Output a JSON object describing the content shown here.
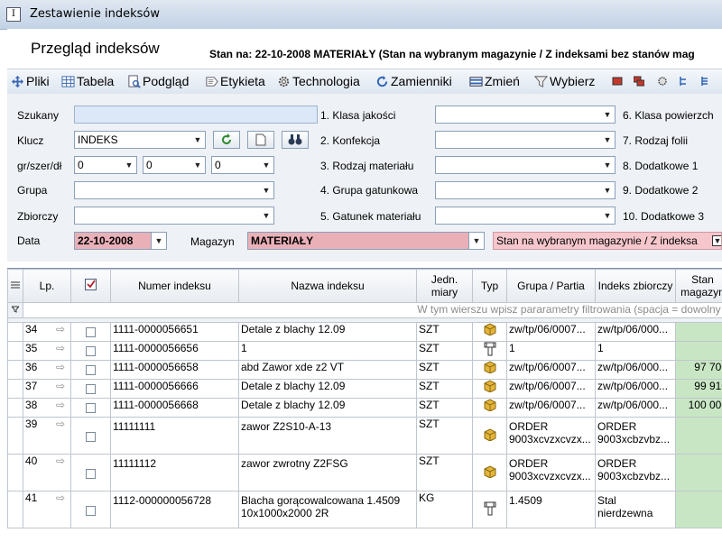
{
  "window": {
    "title": "Zestawienie indeksów",
    "icon": "I"
  },
  "header": {
    "title": "Przegląd indeksów",
    "status": "Stan na: 22-10-2008  MATERIAŁY  (Stan na wybranym magazynie / Z indeksami bez stanów mag"
  },
  "toolbar": {
    "items": [
      {
        "label": "Pliki",
        "icon": "move-icon"
      },
      {
        "label": "Tabela",
        "icon": "table-icon"
      },
      {
        "label": "Podgląd",
        "icon": "preview-icon"
      },
      {
        "label": "Etykieta",
        "icon": "label-icon"
      },
      {
        "label": "Technologia",
        "icon": "technology-icon"
      },
      {
        "label": "Zamienniki",
        "icon": "refresh-icon"
      },
      {
        "label": "Zmień",
        "icon": "edit-icon"
      },
      {
        "label": "Wybierz",
        "icon": "filter-icon"
      }
    ]
  },
  "form": {
    "szukany": {
      "label": "Szukany",
      "value": ""
    },
    "klucz": {
      "label": "Klucz",
      "value": "INDEKS"
    },
    "gsd": {
      "label": "gr/szer/dł",
      "values": [
        "0",
        "0",
        "0"
      ]
    },
    "grupa": {
      "label": "Grupa",
      "value": ""
    },
    "zbiorczy": {
      "label": "Zbiorczy",
      "value": ""
    },
    "data": {
      "label": "Data",
      "value": "22-10-2008"
    },
    "magazyn": {
      "label": "Magazyn",
      "value": "MATERIAŁY"
    },
    "stan_option": "Stan na wybranym magazynie / Z indeksa",
    "mid": [
      "1. Klasa jakości",
      "2. Konfekcja",
      "3. Rodzaj materiału",
      "4. Grupa gatunkowa",
      "5. Gatunek materiału"
    ],
    "right": [
      "6. Klasa powierzch",
      "7. Rodzaj folii",
      "8. Dodatkowe 1",
      "9. Dodatkowe 2",
      "10. Dodatkowe 3"
    ]
  },
  "grid": {
    "columns": [
      "Lp.",
      "",
      "Numer indeksu",
      "Nazwa indeksu",
      "Jedn. miary",
      "Typ",
      "Grupa / Partia",
      "Indeks zbiorczy",
      "Stan magazyn"
    ],
    "filter_hint": "W tym wierszu wpisz pararametry filtrowania (spacja = dowolny c",
    "rows": [
      {
        "lp": "34",
        "numer": "1111-0000056651",
        "nazwa": "Detale z blachy 12.09",
        "jm": "SZT",
        "typ": "box",
        "grupa": "zw/tp/06/0007...",
        "zbiorczy": "zw/tp/06/000...",
        "stan": ""
      },
      {
        "lp": "35",
        "numer": "1111-0000056656",
        "nazwa": "1",
        "jm": "SZT",
        "typ": "tool",
        "grupa": "1",
        "zbiorczy": "1",
        "stan": ""
      },
      {
        "lp": "36",
        "numer": "1111-0000056658",
        "nazwa": "abd Zawor  xde z2 VT",
        "jm": "SZT",
        "typ": "box",
        "grupa": "zw/tp/06/0007...",
        "zbiorczy": "zw/tp/06/000...",
        "stan": "97 700"
      },
      {
        "lp": "37",
        "numer": "1111-0000056666",
        "nazwa": "Detale z blachy 12.09",
        "jm": "SZT",
        "typ": "box",
        "grupa": "zw/tp/06/0007...",
        "zbiorczy": "zw/tp/06/000...",
        "stan": "99 910"
      },
      {
        "lp": "38",
        "numer": "1111-0000056668",
        "nazwa": "Detale z blachy 12.09",
        "jm": "SZT",
        "typ": "box",
        "grupa": "zw/tp/06/0007...",
        "zbiorczy": "zw/tp/06/000...",
        "stan": "100 000"
      },
      {
        "lp": "39",
        "numer": "11111111",
        "nazwa": "zawor Z2S10-A-13",
        "jm": "SZT",
        "typ": "box",
        "grupa": "ORDER 9003xcvzxcvzx...",
        "zbiorczy": "ORDER 9003xcbzvbz...",
        "stan": ""
      },
      {
        "lp": "40",
        "numer": "11111112",
        "nazwa": "zawor zwrotny Z2FSG",
        "jm": "SZT",
        "typ": "box",
        "grupa": "ORDER 9003xcvzxcvzx...",
        "zbiorczy": "ORDER 9003xcbzvbz...",
        "stan": ""
      },
      {
        "lp": "41",
        "numer": "1112-000000056728",
        "nazwa": "Blacha gorącowalcowana 1.4509 10x1000x2000 2R",
        "jm": "KG",
        "typ": "tool",
        "grupa": "1.4509",
        "zbiorczy": "Stal nierdzewna",
        "stan": ""
      }
    ]
  }
}
